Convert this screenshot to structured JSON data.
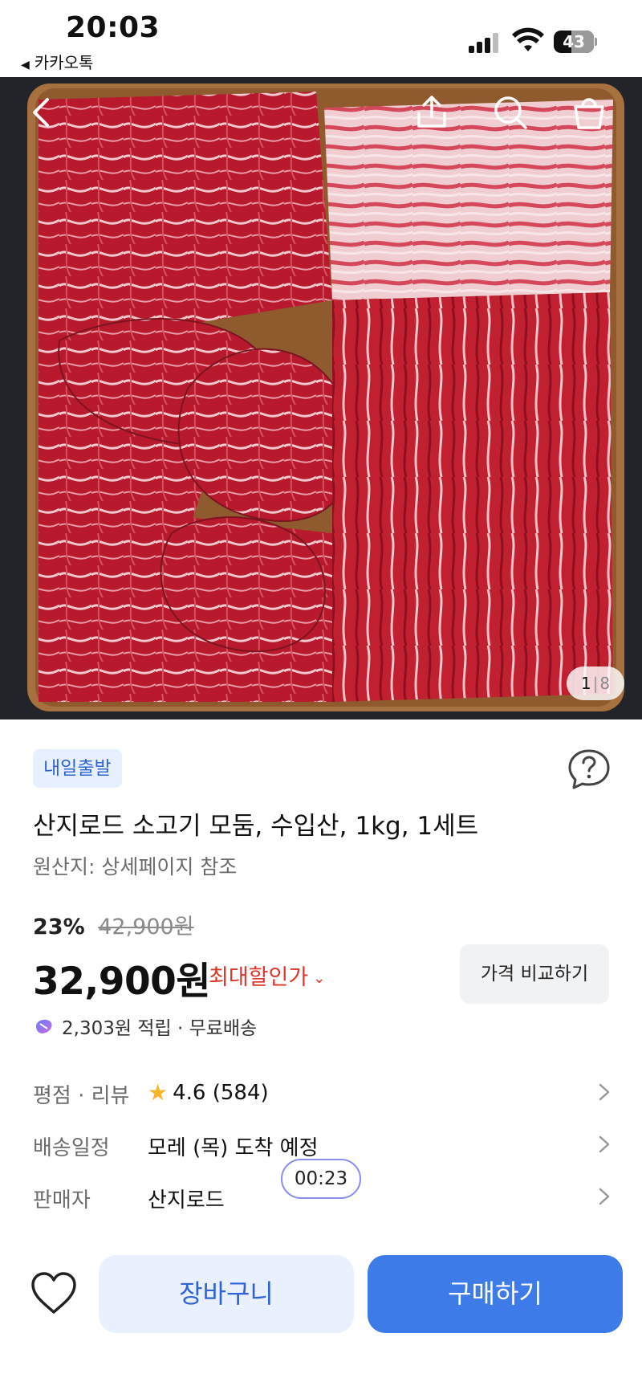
{
  "status_bar": {
    "time": "20:03",
    "back_app_label": "카카오톡",
    "battery_level": "43",
    "battery_fraction": 0.43
  },
  "hero": {
    "page_current": "1",
    "page_separator": "|",
    "page_total": "8",
    "icons": [
      "back-icon",
      "share-icon",
      "search-icon",
      "shopping-bag-icon"
    ]
  },
  "product": {
    "badge": "내일출발",
    "title": "산지로드 소고기 모둠, 수입산, 1kg, 1세트",
    "origin": "원산지: 상세페이지 참조",
    "discount_percent": "23%",
    "original_price": "42,900원",
    "price": "32,900원",
    "max_discount_label": "최대할인가",
    "compare_label": "가격 비교하기",
    "points_text": "2,303원 적립 · 무료배송"
  },
  "info_rows": [
    {
      "label": "평점 · 리뷰",
      "value": "4.6 (584)"
    },
    {
      "label": "배송일정",
      "value": "모레 (목) 도착 예정"
    },
    {
      "label": "판매자",
      "value": "산지로드"
    }
  ],
  "timer": "00:23",
  "bottom_bar": {
    "cart_label": "장바구니",
    "buy_label": "구매하기"
  },
  "colors": {
    "accent_blue": "#3d7ce8",
    "badge_bg": "#e7f0ff",
    "discount_red": "#e0352b",
    "star_yellow": "#f6b52b"
  }
}
